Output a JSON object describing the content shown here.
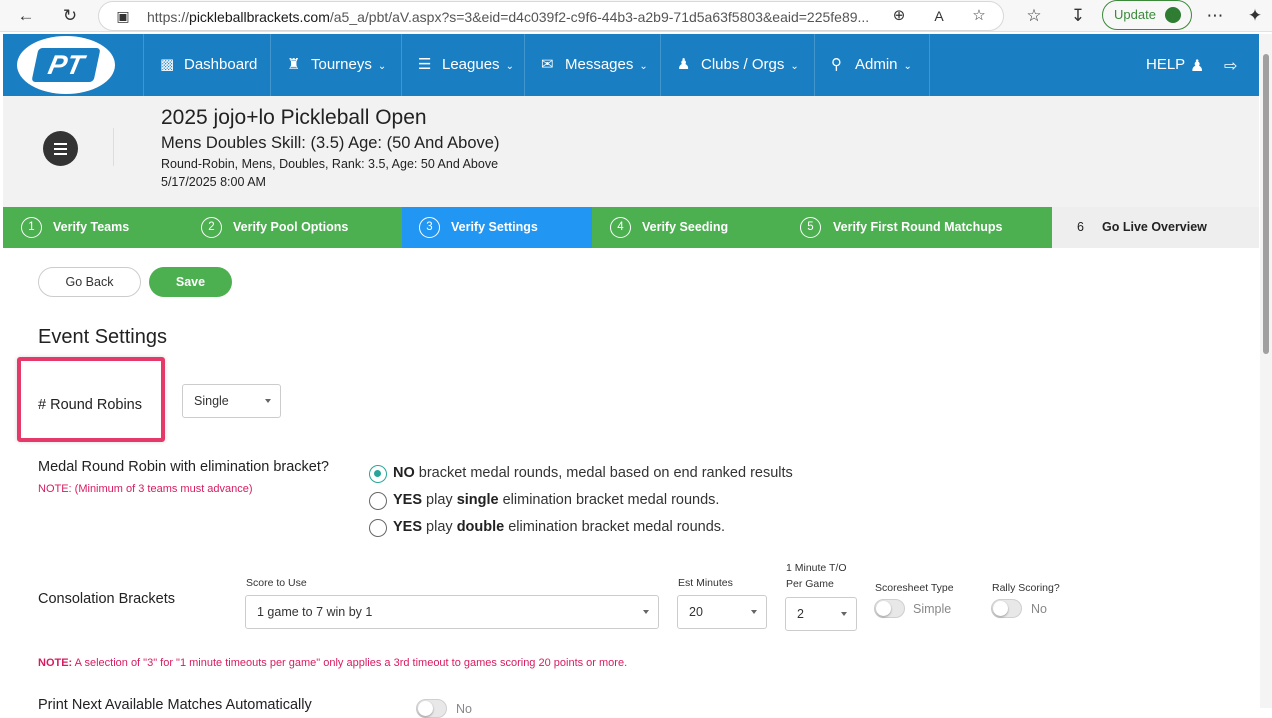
{
  "browser": {
    "url_host": "pickleballbrackets.com",
    "url_prefix": "https://",
    "url_path": "/a5_a/pbt/aV.aspx?s=3&eid=d4c039f2-c9f6-44b3-a2b9-71d5a63f5803&eaid=225fe89...",
    "update_label": "Update"
  },
  "nav": {
    "logo_text": "PT",
    "items": [
      {
        "label": "Dashboard",
        "icon": "bar-chart-icon"
      },
      {
        "label": "Tourneys",
        "icon": "trophy-icon"
      },
      {
        "label": "Leagues",
        "icon": "sliders-icon"
      },
      {
        "label": "Messages",
        "icon": "inbox-icon"
      },
      {
        "label": "Clubs / Orgs",
        "icon": "users-icon"
      },
      {
        "label": "Admin",
        "icon": "map-pin-icon"
      }
    ],
    "help_label": "HELP"
  },
  "event": {
    "title": "2025 jojo+lo Pickleball Open",
    "division": "Mens Doubles Skill: (3.5) Age: (50 And Above)",
    "meta": "Round-Robin, Mens, Doubles, Rank: 3.5, Age: 50 And Above",
    "date": "5/17/2025 8:00 AM"
  },
  "steps": [
    {
      "num": "1",
      "label": "Verify Teams",
      "state": "done"
    },
    {
      "num": "2",
      "label": "Verify Pool Options",
      "state": "done"
    },
    {
      "num": "3",
      "label": "Verify Settings",
      "state": "active"
    },
    {
      "num": "4",
      "label": "Verify Seeding",
      "state": "todo"
    },
    {
      "num": "5",
      "label": "Verify First Round Matchups",
      "state": "todo"
    },
    {
      "num": "6",
      "label": "Go Live Overview",
      "state": "final"
    }
  ],
  "actions": {
    "back": "Go Back",
    "save": "Save"
  },
  "settings": {
    "heading": "Event Settings",
    "round_robins_label": "# Round Robins",
    "round_robins_value": "Single",
    "medal_question": "Medal Round Robin with elimination bracket?",
    "medal_note": "NOTE: (Minimum of 3 teams must advance)",
    "medal_options": [
      {
        "strong": "NO",
        "mid": " bracket medal rounds, medal based on end ranked results",
        "bold2": "",
        "tail": "",
        "selected": true
      },
      {
        "strong": "YES",
        "mid": " play ",
        "bold2": "single",
        "tail": " elimination bracket medal rounds.",
        "selected": false
      },
      {
        "strong": "YES",
        "mid": " play ",
        "bold2": "double",
        "tail": " elimination bracket medal rounds.",
        "selected": false
      }
    ],
    "consolation_label": "Consolation Brackets",
    "score_to_use_label": "Score to Use",
    "score_to_use_value": "1 game to 7 win by 1",
    "est_minutes_label": "Est Minutes",
    "est_minutes_value": "20",
    "timeout_label_1": "1 Minute T/O",
    "timeout_label_2": "Per Game",
    "timeout_value": "2",
    "scoresheet_label": "Scoresheet Type",
    "scoresheet_value": "Simple",
    "rally_label": "Rally Scoring?",
    "rally_value": "No",
    "timeout_note_key": "NOTE:",
    "timeout_note": " A selection of \"3\" for \"1 minute timeouts per game\" only applies a 3rd timeout to games scoring 20 points or more.",
    "print_label": "Print Next Available Matches Automatically",
    "print_value": "No"
  },
  "colors": {
    "nav": "#1a7ec3",
    "step_done": "#4caf50",
    "step_active": "#2196f3",
    "step_final": "#eeeeee",
    "highlight": "#e5396a",
    "note": "#d81b60"
  }
}
